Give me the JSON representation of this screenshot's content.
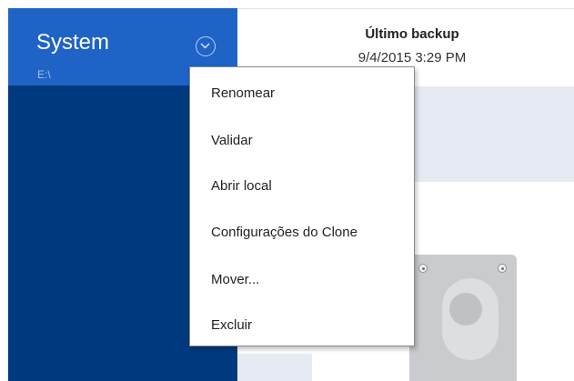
{
  "sidebar": {
    "selected_item": {
      "title": "System",
      "subtitle": "E:\\",
      "options_icon": "chevron-down-circle-icon"
    }
  },
  "main": {
    "last_backup_label": "Último backup",
    "last_backup_date": "9/4/2015 3:29 PM",
    "drive_icon": "hard-drive-icon"
  },
  "context_menu": {
    "items": [
      {
        "label": "Renomear"
      },
      {
        "label": "Validar"
      },
      {
        "label": "Abrir local"
      },
      {
        "label": "Configurações do Clone"
      },
      {
        "label": "Mover..."
      },
      {
        "label": "Excluir"
      }
    ]
  },
  "colors": {
    "sidebar_bg": "#003a7e",
    "sidebar_selected": "#1f63c6",
    "info_band": "#e6eaf3"
  }
}
